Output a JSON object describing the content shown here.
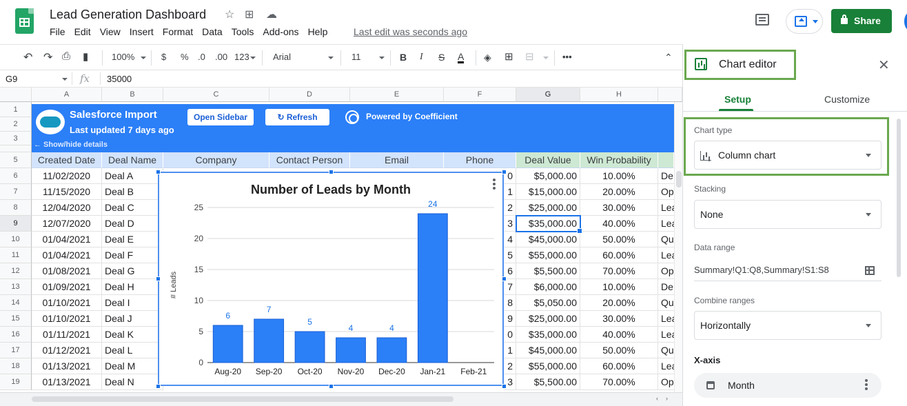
{
  "header": {
    "title": "Lead Generation Dashboard",
    "last_edit": "Last edit was seconds ago",
    "share_label": "Share",
    "menu": [
      "File",
      "Edit",
      "View",
      "Insert",
      "Format",
      "Data",
      "Tools",
      "Add-ons",
      "Help"
    ]
  },
  "toolbar": {
    "zoom": "100%",
    "currency": "$",
    "percent": "%",
    "decrease_decimal": ".0",
    "increase_decimal": ".00",
    "more_formats": "123",
    "font": "Arial",
    "font_size": "11",
    "bold": "B",
    "italic": "I",
    "strike": "S",
    "text_color": "A"
  },
  "formula_bar": {
    "cell_ref": "G9",
    "fx": "fx",
    "value": "35000"
  },
  "columns": [
    "A",
    "B",
    "C",
    "D",
    "E",
    "F",
    "G",
    "H"
  ],
  "rows": [
    "1",
    "2",
    "3",
    "4",
    "5",
    "6",
    "7",
    "8",
    "9",
    "10",
    "11",
    "12",
    "13",
    "14",
    "15",
    "16",
    "17",
    "18",
    "19"
  ],
  "banner": {
    "title": "Salesforce Import",
    "subtitle": "Last updated 7 days ago",
    "open_sidebar": "Open Sidebar",
    "refresh": "Refresh",
    "powered_by": "Powered by Coefficient",
    "show_hide": "← Show/hide details"
  },
  "table": {
    "headers": [
      "Created Date",
      "Deal Name",
      "Company",
      "Contact Person",
      "Email",
      "Phone",
      "Deal Value",
      "Win Probability"
    ],
    "rows": [
      {
        "date": "11/02/2020",
        "deal": "Deal A",
        "phone_tail": "0",
        "value": "$5,000.00",
        "prob": "10.00%",
        "extra": "De"
      },
      {
        "date": "11/15/2020",
        "deal": "Deal B",
        "phone_tail": "1",
        "value": "$15,000.00",
        "prob": "20.00%",
        "extra": "Op"
      },
      {
        "date": "12/04/2020",
        "deal": "Deal C",
        "phone_tail": "2",
        "value": "$25,000.00",
        "prob": "30.00%",
        "extra": "Lea"
      },
      {
        "date": "12/07/2020",
        "deal": "Deal D",
        "phone_tail": "3",
        "value": "$35,000.00",
        "prob": "40.00%",
        "extra": "Lea"
      },
      {
        "date": "01/04/2021",
        "deal": "Deal E",
        "phone_tail": "4",
        "value": "$45,000.00",
        "prob": "50.00%",
        "extra": "Qu"
      },
      {
        "date": "01/04/2021",
        "deal": "Deal F",
        "phone_tail": "5",
        "value": "$55,000.00",
        "prob": "60.00%",
        "extra": "Lea"
      },
      {
        "date": "01/08/2021",
        "deal": "Deal G",
        "phone_tail": "6",
        "value": "$5,500.00",
        "prob": "70.00%",
        "extra": "Op"
      },
      {
        "date": "01/09/2021",
        "deal": "Deal H",
        "phone_tail": "7",
        "value": "$6,000.00",
        "prob": "10.00%",
        "extra": "De"
      },
      {
        "date": "01/10/2021",
        "deal": "Deal I",
        "phone_tail": "8",
        "value": "$5,050.00",
        "prob": "20.00%",
        "extra": "Qu"
      },
      {
        "date": "01/10/2021",
        "deal": "Deal J",
        "phone_tail": "9",
        "value": "$25,000.00",
        "prob": "30.00%",
        "extra": "Lea"
      },
      {
        "date": "01/11/2021",
        "deal": "Deal K",
        "phone_tail": "0",
        "value": "$35,000.00",
        "prob": "40.00%",
        "extra": "Lea"
      },
      {
        "date": "01/12/2021",
        "deal": "Deal L",
        "phone_tail": "1",
        "value": "$45,000.00",
        "prob": "50.00%",
        "extra": "Qu"
      },
      {
        "date": "01/13/2021",
        "deal": "Deal M",
        "phone_tail": "2",
        "value": "$55,000.00",
        "prob": "60.00%",
        "extra": "Lea"
      },
      {
        "date": "01/13/2021",
        "deal": "Deal N",
        "phone_tail": "3",
        "value": "$5,500.00",
        "prob": "70.00%",
        "extra": "Op"
      }
    ]
  },
  "chart_data": {
    "type": "bar",
    "title": "Number of Leads by Month",
    "ylabel": "# Leads",
    "xlabel": "",
    "categories": [
      "Aug-20",
      "Sep-20",
      "Oct-20",
      "Nov-20",
      "Dec-20",
      "Jan-21",
      "Feb-21"
    ],
    "values": [
      6,
      7,
      5,
      4,
      4,
      24,
      null
    ],
    "ylim": [
      0,
      25
    ],
    "yticks": [
      0,
      5,
      10,
      15,
      20,
      25
    ],
    "grid": true,
    "color": "#2b7ff7"
  },
  "editor": {
    "title": "Chart editor",
    "tabs": [
      "Setup",
      "Customize"
    ],
    "chart_type_label": "Chart type",
    "chart_type_value": "Column chart",
    "stacking_label": "Stacking",
    "stacking_value": "None",
    "data_range_label": "Data range",
    "data_range_value": "Summary!Q1:Q8,Summary!S1:S8",
    "combine_label": "Combine ranges",
    "combine_value": "Horizontally",
    "xaxis_title": "X-axis",
    "xaxis_value": "Month"
  },
  "colors": {
    "accent": "#188038",
    "banner": "#2b7ff7",
    "highlight": "#6aa84f"
  }
}
